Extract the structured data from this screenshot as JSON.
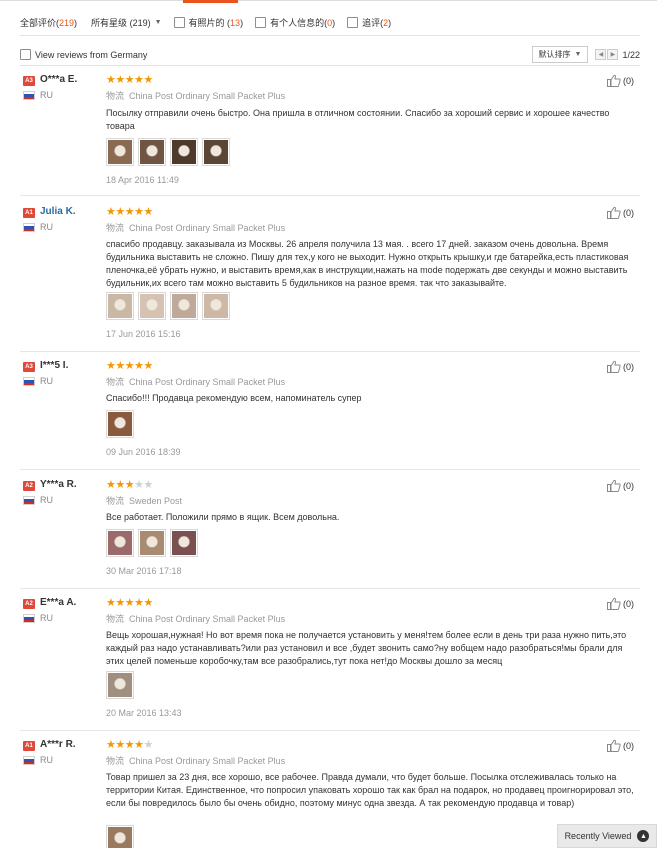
{
  "filters": {
    "all": {
      "label": "全部评价",
      "count": "219"
    },
    "stars": {
      "label": "所有星级",
      "count": "219"
    },
    "photos": {
      "label": "有照片的",
      "count": "13"
    },
    "personal": {
      "label": "有个人信息的",
      "count": "0"
    },
    "comments": {
      "label": "追评",
      "count": "2"
    }
  },
  "options": {
    "view_country": "View reviews from Germany",
    "sort": "默认排序",
    "page": "1/22"
  },
  "shipping_label": "物流",
  "reviews": [
    {
      "badge": "A3",
      "badge_color": "#e0493a",
      "name": "O***a E.",
      "country": "RU",
      "stars": 5,
      "shipping": "China Post Ordinary Small Packet Plus",
      "text": "Посылку отправили очень быстро. Она пришла в отличном состоянии. Спасибо за хороший сервис и хорошее качество товара",
      "date": "18 Apr 2016 11:49",
      "helpful": "(0)",
      "photos": [
        "#8a6a50",
        "#6f5543",
        "#4d3a2c",
        "#5b4534"
      ]
    },
    {
      "badge": "A1",
      "badge_color": "#e0493a",
      "name": "Julia K.",
      "country": "RU",
      "stars": 5,
      "shipping": "China Post Ordinary Small Packet Plus",
      "text": "спасибо продавцу. заказывала из Москвы. 26 апреля получила 13 мая. . всего 17 дней. заказом очень довольна. Время будильника выставить не сложно. Пишу для тех,у кого не выходит. Нужно открыть крышку,и где батарейка,есть пластиковая пленочка,её убрать нужно, и выставить время,как в инструкции,нажать на mode подержать две секунды и можно выставить будильник,их всего там можно выставить 5 будильников на разное время. так что заказывайте.",
      "date": "17 Jun 2016 15:16",
      "helpful": "(0)",
      "photos": [
        "#c9b8a4",
        "#d6c2b3",
        "#bfa99a",
        "#cdb8a5"
      ]
    },
    {
      "badge": "A3",
      "badge_color": "#e0493a",
      "name": "I***5 I.",
      "country": "RU",
      "stars": 5,
      "shipping": "China Post Ordinary Small Packet Plus",
      "text": "Спасибо!!! Продавца рекомендую всем, напоминатель супер",
      "date": "09 Jun 2016 18:39",
      "helpful": "(0)",
      "photos": [
        "#8a5a3e"
      ]
    },
    {
      "badge": "A2",
      "badge_color": "#e0493a",
      "name": "Y***a R.",
      "country": "RU",
      "stars": 3,
      "shipping": "Sweden Post",
      "text": "Все работает. Положили прямо в ящик. Всем довольна.",
      "date": "30 Mar 2016 17:18",
      "helpful": "(0)",
      "photos": [
        "#9b6a6a",
        "#a88b70",
        "#7a5050"
      ]
    },
    {
      "badge": "A2",
      "badge_color": "#e0493a",
      "name": "E***a A.",
      "country": "RU",
      "stars": 5,
      "shipping": "China Post Ordinary Small Packet Plus",
      "text": "Вещь хорошая,нужная! Но вот время пока не получается установить у меня!тем более если в день три раза нужно пить,это каждый раз надо устанавливать?или раз установил и все ,будет звонить само?ну вобщем надо разобраться!мы брали для этих целей поменьше коробочку,там все разобрались,тут пока нет!до Москвы дошло за месяц",
      "date": "20 Mar 2016 13:43",
      "helpful": "(0)",
      "photos": [
        "#a08f7e"
      ]
    },
    {
      "badge": "A1",
      "badge_color": "#e0493a",
      "name": "A***r R.",
      "country": "RU",
      "stars": 4,
      "shipping": "China Post Ordinary Small Packet Plus",
      "text": "Товар пришел за 23 дня, все хорошо, все рабочее. Правда думали, что будет больше. Посылка отслеживалась только на территории Китая. Единственное, что попросил упаковать хорошо так как брал на подарок, но продавец проигнорировал это, если бы повредилось было бы очень обидно, поэтому минус одна звезда. А так рекомендую продавца и товар)",
      "date": "",
      "helpful": "(0)",
      "photos": [
        "#9a7a5e"
      ]
    }
  ],
  "recently_viewed": "Recently Viewed"
}
